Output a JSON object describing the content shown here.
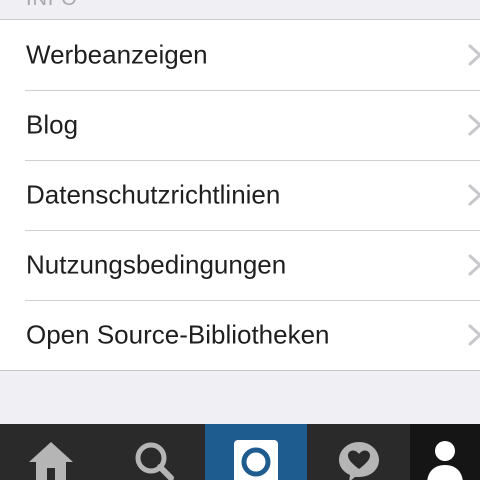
{
  "section": {
    "header": "INFO"
  },
  "menu": {
    "items": [
      {
        "label": "Werbeanzeigen"
      },
      {
        "label": "Blog"
      },
      {
        "label": "Datenschutzrichtlinien"
      },
      {
        "label": "Nutzungsbedingungen"
      },
      {
        "label": "Open Source-Bibliotheken"
      }
    ]
  },
  "tabbar": {
    "tabs": [
      {
        "icon": "home-icon"
      },
      {
        "icon": "search-icon"
      },
      {
        "icon": "camera-icon",
        "active": true
      },
      {
        "icon": "activity-heart-icon"
      },
      {
        "icon": "profile-icon"
      }
    ],
    "active_color": "#1e5c8f",
    "background": "#2a2a2a"
  },
  "colors": {
    "background": "#efeff4",
    "row_background": "#ffffff",
    "separator": "#c8c7cc",
    "text": "#1f1f1f",
    "chevron": "#c7c7cc"
  }
}
